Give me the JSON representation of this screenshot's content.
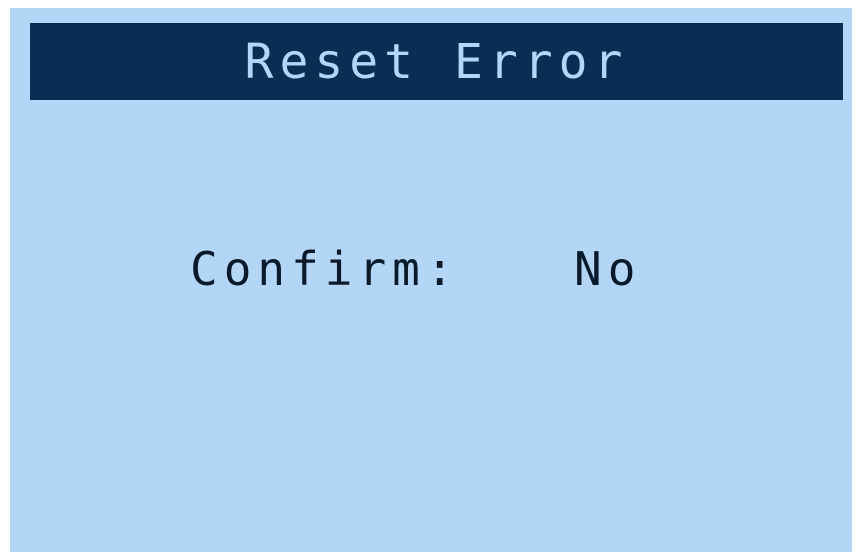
{
  "screen": {
    "title": "Reset Error",
    "confirm_label": "Confirm:",
    "confirm_value": "No"
  },
  "colors": {
    "screen_background": "#b3d5f6",
    "title_bar_background": "#0b2d53",
    "title_text": "#b3d5f6",
    "body_text": "#0b1a2b"
  }
}
